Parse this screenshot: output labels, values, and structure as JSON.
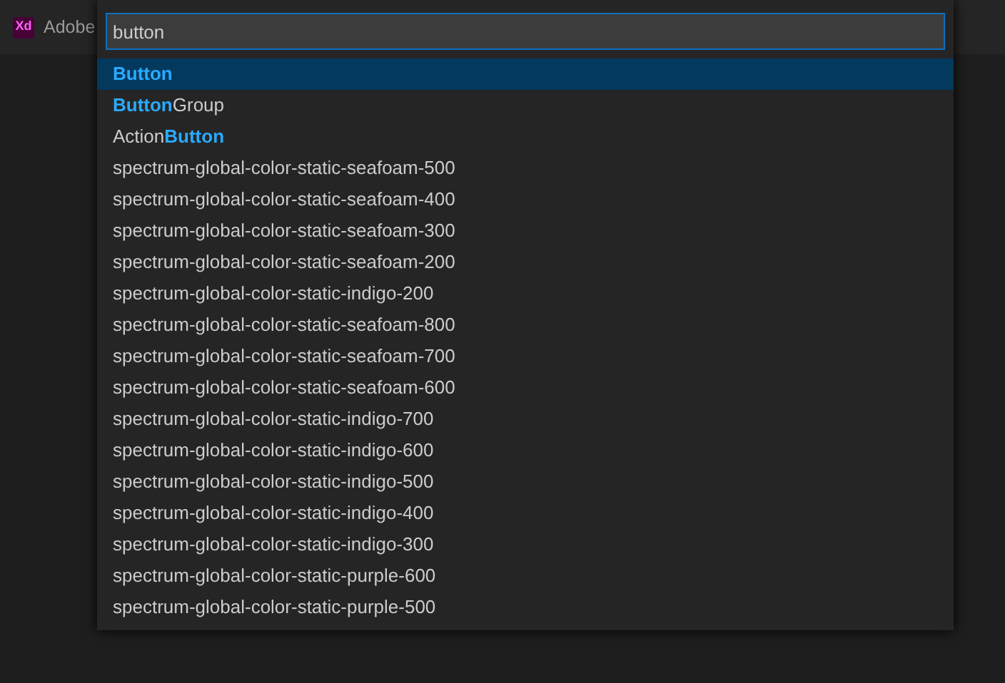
{
  "tab": {
    "logo": "Xd",
    "title": "Adobe"
  },
  "quick_pick": {
    "query": "button",
    "items": [
      {
        "label": "**Button**",
        "selected": true
      },
      {
        "label": "**Button**Group",
        "selected": false
      },
      {
        "label": "Action**Button**",
        "selected": false
      },
      {
        "label": "spectrum-global-color-static-seafoam-500",
        "selected": false
      },
      {
        "label": "spectrum-global-color-static-seafoam-400",
        "selected": false
      },
      {
        "label": "spectrum-global-color-static-seafoam-300",
        "selected": false
      },
      {
        "label": "spectrum-global-color-static-seafoam-200",
        "selected": false
      },
      {
        "label": "spectrum-global-color-static-indigo-200",
        "selected": false
      },
      {
        "label": "spectrum-global-color-static-seafoam-800",
        "selected": false
      },
      {
        "label": "spectrum-global-color-static-seafoam-700",
        "selected": false
      },
      {
        "label": "spectrum-global-color-static-seafoam-600",
        "selected": false
      },
      {
        "label": "spectrum-global-color-static-indigo-700",
        "selected": false
      },
      {
        "label": "spectrum-global-color-static-indigo-600",
        "selected": false
      },
      {
        "label": "spectrum-global-color-static-indigo-500",
        "selected": false
      },
      {
        "label": "spectrum-global-color-static-indigo-400",
        "selected": false
      },
      {
        "label": "spectrum-global-color-static-indigo-300",
        "selected": false
      },
      {
        "label": "spectrum-global-color-static-purple-600",
        "selected": false
      },
      {
        "label": "spectrum-global-color-static-purple-500",
        "selected": false
      }
    ]
  }
}
